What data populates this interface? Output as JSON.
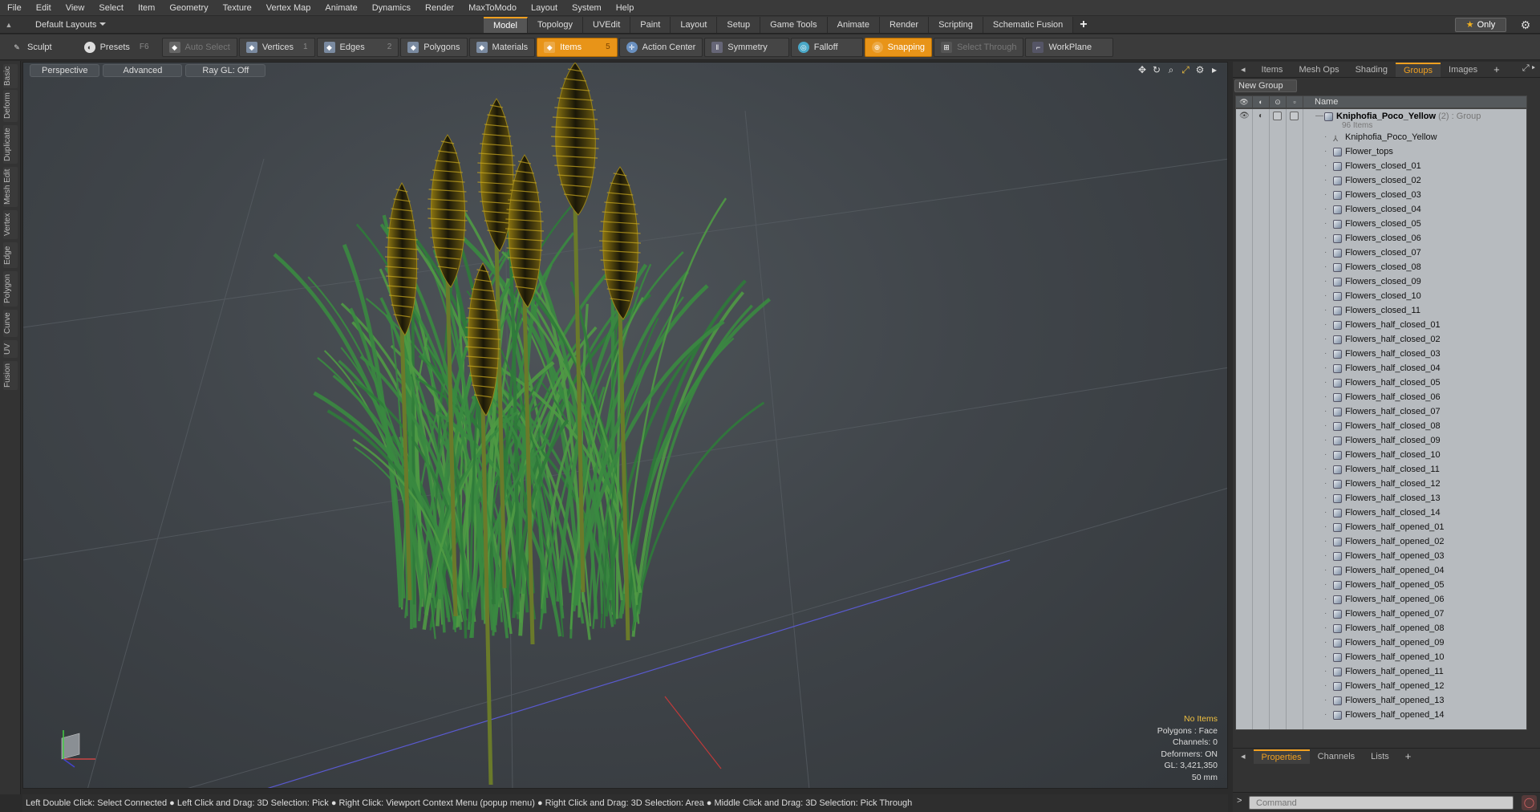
{
  "menu": [
    "File",
    "Edit",
    "View",
    "Select",
    "Item",
    "Geometry",
    "Texture",
    "Vertex Map",
    "Animate",
    "Dynamics",
    "Render",
    "MaxToModo",
    "Layout",
    "System",
    "Help"
  ],
  "layout_selector": {
    "label": "Default Layouts"
  },
  "mode_tabs": [
    {
      "label": "Model",
      "active": true
    },
    {
      "label": "Topology"
    },
    {
      "label": "UVEdit"
    },
    {
      "label": "Paint"
    },
    {
      "label": "Layout"
    },
    {
      "label": "Setup"
    },
    {
      "label": "Game Tools"
    },
    {
      "label": "Animate"
    },
    {
      "label": "Render"
    },
    {
      "label": "Scripting"
    },
    {
      "label": "Schematic Fusion"
    }
  ],
  "only_button": "Only",
  "toolbar": {
    "sculpt": "Sculpt",
    "presets": "Presets",
    "presets_key": "F6",
    "auto_select": "Auto Select",
    "vertices": "Vertices",
    "vertices_key": "1",
    "edges": "Edges",
    "edges_key": "2",
    "polygons": "Polygons",
    "materials": "Materials",
    "items": "Items",
    "items_key": "5",
    "action_center": "Action Center",
    "symmetry": "Symmetry",
    "falloff": "Falloff",
    "snapping": "Snapping",
    "select_through": "Select Through",
    "workplane": "WorkPlane"
  },
  "left_tabs": [
    "Basic",
    "Deform",
    "Duplicate",
    "Mesh Edit",
    "Vertex",
    "Edge",
    "Polygon",
    "Curve",
    "UV",
    "Fusion"
  ],
  "viewport": {
    "view": "Perspective",
    "shading": "Advanced",
    "raygl": "Ray GL: Off",
    "info": {
      "selection": "No Items",
      "polygons": "Polygons : Face",
      "channels": "Channels: 0",
      "deformers": "Deformers: ON",
      "gl": "GL: 3,421,350",
      "focal": "50 mm"
    }
  },
  "status_bar": "Left Double Click: Select Connected ● Left Click and Drag: 3D Selection: Pick ● Right Click: Viewport Context Menu (popup menu) ● Right Click and Drag: 3D Selection: Area ● Middle Click and Drag: 3D Selection: Pick Through",
  "right_panel": {
    "tabs": [
      {
        "label": "Items"
      },
      {
        "label": "Mesh Ops"
      },
      {
        "label": "Shading"
      },
      {
        "label": "Groups",
        "active": true
      },
      {
        "label": "Images"
      }
    ],
    "new_group": "New Group",
    "name_header": "Name",
    "group": {
      "name": "Kniphofia_Poco_Yellow",
      "count": "(2)",
      "type": ": Group",
      "items": "96 Items"
    },
    "locator": "Kniphofia_Poco_Yellow",
    "meshes": [
      "Flower_tops",
      "Flowers_closed_01",
      "Flowers_closed_02",
      "Flowers_closed_03",
      "Flowers_closed_04",
      "Flowers_closed_05",
      "Flowers_closed_06",
      "Flowers_closed_07",
      "Flowers_closed_08",
      "Flowers_closed_09",
      "Flowers_closed_10",
      "Flowers_closed_11",
      "Flowers_half_closed_01",
      "Flowers_half_closed_02",
      "Flowers_half_closed_03",
      "Flowers_half_closed_04",
      "Flowers_half_closed_05",
      "Flowers_half_closed_06",
      "Flowers_half_closed_07",
      "Flowers_half_closed_08",
      "Flowers_half_closed_09",
      "Flowers_half_closed_10",
      "Flowers_half_closed_11",
      "Flowers_half_closed_12",
      "Flowers_half_closed_13",
      "Flowers_half_closed_14",
      "Flowers_half_opened_01",
      "Flowers_half_opened_02",
      "Flowers_half_opened_03",
      "Flowers_half_opened_04",
      "Flowers_half_opened_05",
      "Flowers_half_opened_06",
      "Flowers_half_opened_07",
      "Flowers_half_opened_08",
      "Flowers_half_opened_09",
      "Flowers_half_opened_10",
      "Flowers_half_opened_11",
      "Flowers_half_opened_12",
      "Flowers_half_opened_13",
      "Flowers_half_opened_14"
    ],
    "bottom_tabs": [
      {
        "label": "Properties",
        "active": true
      },
      {
        "label": "Channels"
      },
      {
        "label": "Lists"
      }
    ],
    "command_placeholder": "Command"
  },
  "colors": {
    "accent": "#e89418",
    "viewport_bg": "#40454a",
    "list_bg": "#b7bbbf"
  }
}
